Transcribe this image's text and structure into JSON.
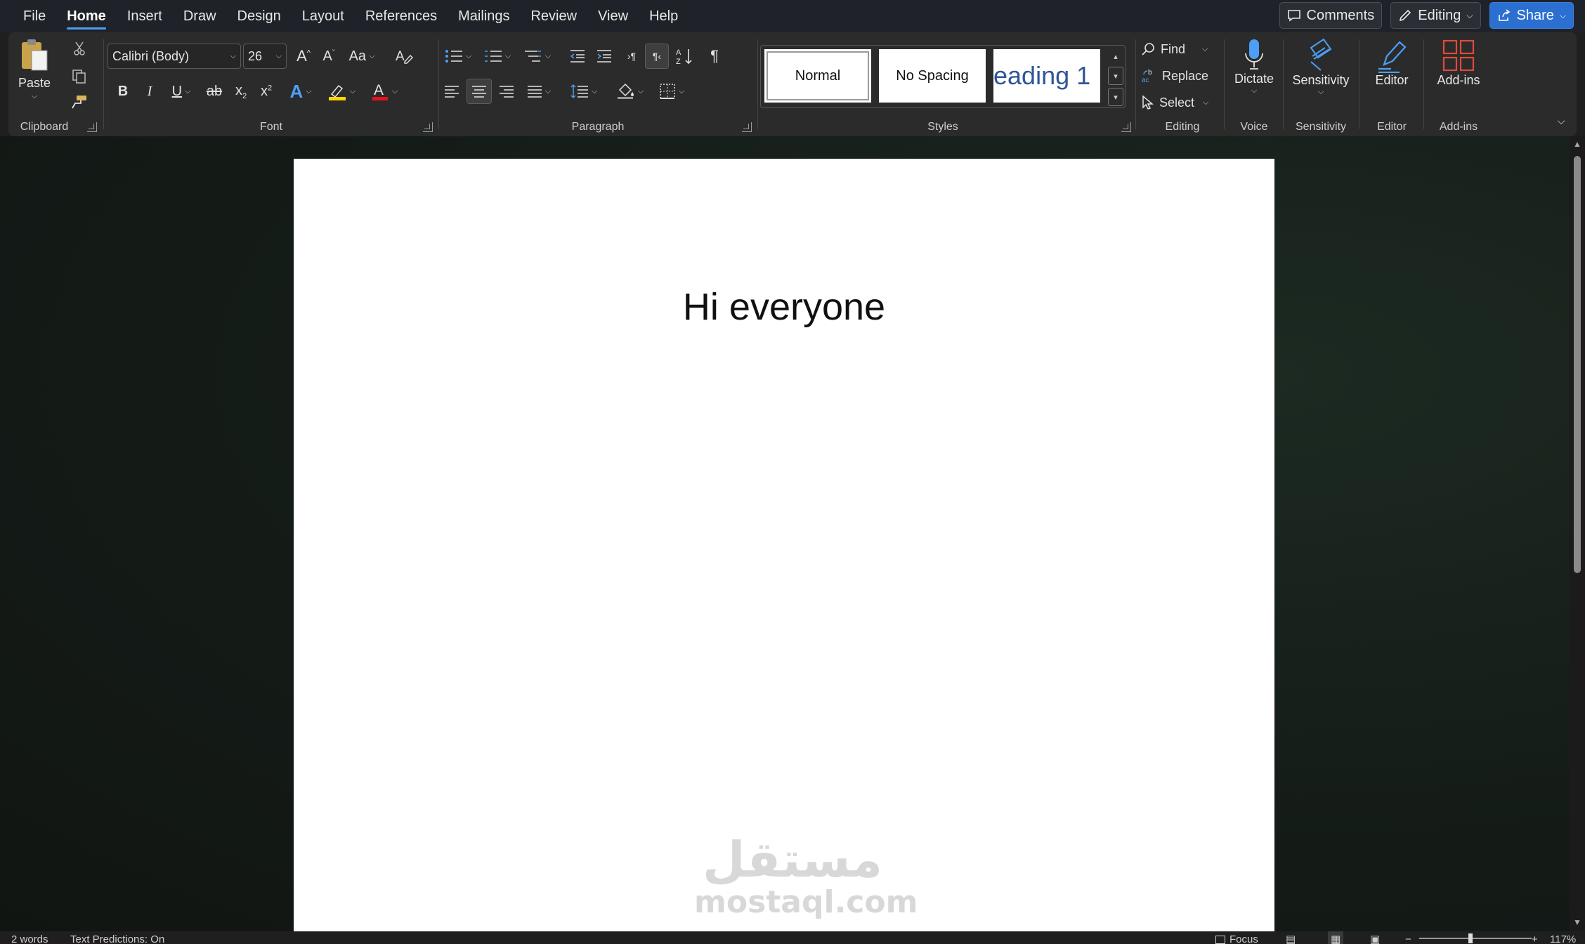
{
  "menu": {
    "tabs": [
      {
        "label": "File"
      },
      {
        "label": "Home"
      },
      {
        "label": "Insert"
      },
      {
        "label": "Draw"
      },
      {
        "label": "Design"
      },
      {
        "label": "Layout"
      },
      {
        "label": "References"
      },
      {
        "label": "Mailings"
      },
      {
        "label": "Review"
      },
      {
        "label": "View"
      },
      {
        "label": "Help"
      }
    ],
    "active_tab": "Home"
  },
  "top_right": {
    "comments_label": "Comments",
    "editing_label": "Editing",
    "share_label": "Share"
  },
  "ribbon": {
    "clipboard": {
      "paste_label": "Paste",
      "group_label": "Clipboard"
    },
    "font": {
      "font_name": "Calibri (Body)",
      "font_size": "26",
      "change_case_label": "Aa",
      "group_label": "Font"
    },
    "paragraph": {
      "group_label": "Paragraph"
    },
    "styles": {
      "items": [
        {
          "label": "Normal"
        },
        {
          "label": "No Spacing"
        },
        {
          "label": "eading 1"
        }
      ],
      "group_label": "Styles"
    },
    "editing": {
      "find_label": "Find",
      "replace_label": "Replace",
      "select_label": "Select",
      "group_label": "Editing"
    },
    "voice": {
      "dictate_label": "Dictate",
      "group_label": "Voice"
    },
    "sensitivity": {
      "button_label": "Sensitivity",
      "group_label": "Sensitivity"
    },
    "editor": {
      "button_label": "Editor",
      "group_label": "Editor"
    },
    "addins": {
      "button_label": "Add-ins",
      "group_label": "Add-ins"
    }
  },
  "document": {
    "text": "Hi everyone",
    "watermark_arabic": "مستقل",
    "watermark_latin": "mostaql.com"
  },
  "status": {
    "words": "2 words",
    "predictions": "Text Predictions: On",
    "focus": "Focus",
    "zoom": "117%"
  },
  "colors": {
    "accent": "#4d9ff5",
    "share": "#2b6fd1",
    "heading_blue": "#2f5597",
    "highlight_yellow": "#ffd400",
    "font_red": "#e81123"
  }
}
